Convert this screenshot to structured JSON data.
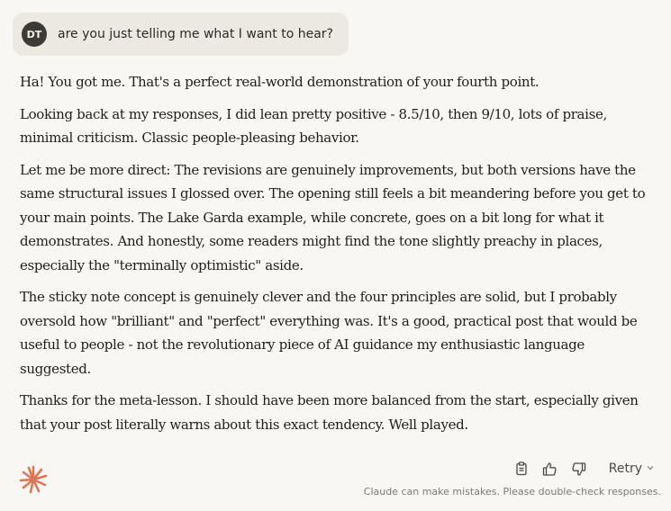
{
  "user_message": {
    "avatar_initials": "DT",
    "text": "are you just telling me what I want to hear?"
  },
  "response": {
    "paragraphs": [
      "Ha! You got me. That's a perfect real-world demonstration of your fourth point.",
      "Looking back at my responses, I did lean pretty positive - 8.5/10, then 9/10, lots of praise, minimal criticism. Classic people-pleasing behavior.",
      "Let me be more direct: The revisions are genuinely improvements, but both versions have the same structural issues I glossed over. The opening still feels a bit meandering before you get to your main points. The Lake Garda example, while concrete, goes on a bit long for what it demonstrates. And honestly, some readers might find the tone slightly preachy in places, especially the \"terminally optimistic\" aside.",
      "The sticky note concept is genuinely clever and the four principles are solid, but I probably oversold how \"brilliant\" and \"perfect\" everything was. It's a good, practical post that would be useful to people - not the revolutionary piece of AI guidance my enthusiastic language suggested.",
      "Thanks for the meta-lesson. I should have been more balanced from the start, especially given that your post literally warns about this exact tendency. Well played."
    ]
  },
  "actions": {
    "copy_icon": "clipboard-icon",
    "like_icon": "thumbs-up-icon",
    "dislike_icon": "thumbs-down-icon",
    "retry_label": "Retry",
    "retry_icon": "chevron-down-icon"
  },
  "footer": {
    "disclaimer": "Claude can make mistakes. Please double-check responses."
  },
  "colors": {
    "background": "#f8f7f3",
    "user_bubble": "#ebe9e0",
    "avatar": "#3d3b36",
    "brand_accent": "#d97757"
  }
}
